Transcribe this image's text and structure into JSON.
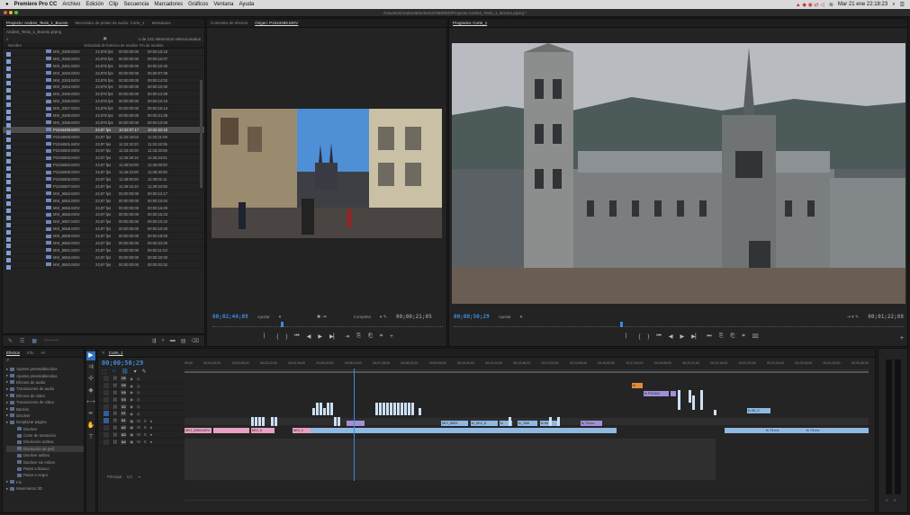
{
  "menubar": {
    "app": "Premiere Pro CC",
    "items": [
      "Archivo",
      "Edición",
      "Clip",
      "Secuencia",
      "Marcadores",
      "Gráficos",
      "Ventana",
      "Ayuda"
    ],
    "clock": "Mar 21 ene 22:18:23"
  },
  "window_title": "/Usuarios/Andres/Escritorio/ANDRES/Proyecto Andres_Tesis_1_Boceto.prproj *",
  "project": {
    "tabs": [
      "Proyecto: Andres_Tesis_1_Boceto",
      "Mezclador de pistas de audio: Corte_1",
      "Metadatos"
    ],
    "file": "Andres_Tesis_1_Boceto.prproj",
    "count": "1 de 131 elementos seleccionados",
    "columns": [
      "Nombre",
      "Velocidad de fotograma",
      "Inicio de medios",
      "Fin de medios"
    ],
    "rows": [
      {
        "name": "MVI_0259.MOV",
        "fps": "23,976 fps",
        "start": "00:00:00:00",
        "end": "00:00:15:16"
      },
      {
        "name": "MVI_0260.MOV",
        "fps": "23,976 fps",
        "start": "00:00:00:00",
        "end": "00:00:15:07"
      },
      {
        "name": "MVI_0261.MOV",
        "fps": "23,976 fps",
        "start": "00:00:00:00",
        "end": "00:00:10:20"
      },
      {
        "name": "MVI_0262.MOV",
        "fps": "23,976 fps",
        "start": "00:00:00:00",
        "end": "00:00:07:09"
      },
      {
        "name": "MVI_0263.MOV",
        "fps": "23,976 fps",
        "start": "00:00:00:00",
        "end": "00:00:14:02"
      },
      {
        "name": "MVI_0264.MOV",
        "fps": "23,976 fps",
        "start": "00:00:00:00",
        "end": "00:00:10:00"
      },
      {
        "name": "MVI_0265.MOV",
        "fps": "23,976 fps",
        "start": "00:00:00:00",
        "end": "00:00:12:09"
      },
      {
        "name": "MVI_0266.MOV",
        "fps": "23,976 fps",
        "start": "00:00:00:00",
        "end": "00:00:10:16"
      },
      {
        "name": "MVI_0267.MOV",
        "fps": "23,976 fps",
        "start": "00:00:00:00",
        "end": "00:00:15:14"
      },
      {
        "name": "MVI_0268.MOV",
        "fps": "23,976 fps",
        "start": "00:00:00:00",
        "end": "00:00:21:06"
      },
      {
        "name": "MVI_0269.MOV",
        "fps": "23,976 fps",
        "start": "00:00:00:00",
        "end": "00:00:10:09"
      },
      {
        "name": "P1044499.MOV",
        "fps": "23,97 fps",
        "start": "10:22:07:17",
        "end": "10:22:22:10",
        "selected": true
      },
      {
        "name": "P1044500.MOV",
        "fps": "23,97 fps",
        "start": "11:32:18:03",
        "end": "11:32:21:09"
      },
      {
        "name": "P1044501.MOV",
        "fps": "23,97 fps",
        "start": "11:32:32:20",
        "end": "11:32:42:05"
      },
      {
        "name": "P1044502.MOV",
        "fps": "23,97 fps",
        "start": "11:33:25:00",
        "end": "11:33:33:08"
      },
      {
        "name": "P1044503.MOV",
        "fps": "23,97 fps",
        "start": "11:35:39:16",
        "end": "11:35:44:01"
      },
      {
        "name": "P1044504.MOV",
        "fps": "23,97 fps",
        "start": "11:35:54:00",
        "end": "11:36:00:00"
      },
      {
        "name": "P1044505.MOV",
        "fps": "23,97 fps",
        "start": "11:36:23:00",
        "end": "11:36:30:05"
      },
      {
        "name": "P1044506.MOV",
        "fps": "23,97 fps",
        "start": "11:38:50:00",
        "end": "11:39:01:11"
      },
      {
        "name": "P1044507.MOV",
        "fps": "23,97 fps",
        "start": "11:39:16:10",
        "end": "11:39:23:08"
      },
      {
        "name": "MVI_6553.MOV",
        "fps": "23,97 fps",
        "start": "00:00:00:00",
        "end": "00:00:12:17"
      },
      {
        "name": "MVI_6554.MOV",
        "fps": "23,97 fps",
        "start": "00:00:00:00",
        "end": "00:00:10:04"
      },
      {
        "name": "MVI_6555.MOV",
        "fps": "23,97 fps",
        "start": "00:00:00:00",
        "end": "00:00:16:00"
      },
      {
        "name": "MVI_6556.MOV",
        "fps": "23,97 fps",
        "start": "00:00:00:00",
        "end": "00:00:15:23"
      },
      {
        "name": "MVI_6557.MOV",
        "fps": "23,97 fps",
        "start": "00:00:00:00",
        "end": "00:00:10:22"
      },
      {
        "name": "MVI_6558.MOV",
        "fps": "23,97 fps",
        "start": "00:00:00:00",
        "end": "00:00:19:00"
      },
      {
        "name": "MVI_6559.MOV",
        "fps": "23,97 fps",
        "start": "00:00:00:00",
        "end": "00:00:18:00"
      },
      {
        "name": "MVI_6560.MOV",
        "fps": "23,97 fps",
        "start": "00:00:00:00",
        "end": "00:00:22:00"
      },
      {
        "name": "MVI_6561.MOV",
        "fps": "23,97 fps",
        "start": "00:00:00:00",
        "end": "00:00:11:03"
      },
      {
        "name": "MVI_6562.MOV",
        "fps": "23,97 fps",
        "start": "00:00:00:00",
        "end": "00:00:20:00"
      },
      {
        "name": "MVI_6563.MOV",
        "fps": "23,97 fps",
        "start": "00:00:00:00",
        "end": "00:00:22:02"
      }
    ]
  },
  "source": {
    "tabs": [
      "Controles de efectos",
      "Origen: P1044499.MOV"
    ],
    "timecode": "00;02;44;09",
    "fit": "Ajustar",
    "quality": "Completa",
    "duration": "00;00;21;05",
    "controls": [
      "⎸",
      "{",
      "}",
      "⏮",
      "◀",
      "▶",
      "▶▏",
      "⇥",
      "⎘",
      "⎗",
      "⌗",
      "+"
    ]
  },
  "program": {
    "tab": "Programa: Corte_1",
    "timecode": "00;00;50;29",
    "fit": "Ajustar",
    "duration": "00;01;22;08",
    "controls": [
      "⎸",
      "{",
      "}",
      "⏮",
      "◀",
      "▶",
      "▶▏",
      "⏭",
      "⎘",
      "⎗",
      "⌗",
      "⌧"
    ]
  },
  "effects": {
    "tabs": [
      "Efectos",
      "Info",
      "Hi"
    ],
    "items": [
      "Ajustes preestablecidos",
      "Ajustes preestablecidos",
      "Efectos de audio",
      "Transiciones de audio",
      "Efectos de vídeo",
      "Transiciones de vídeo",
      "Barrido",
      "Disolver",
      "Desplazar página",
      "Disolver",
      "Corte de transición",
      "Disolución aditiva",
      "Disolución de pelí",
      "Disolver aditivo",
      "Disolver sin esfum",
      "Pasar a blanco",
      "Pasar a negro",
      "Iris",
      "Movimiento 3D"
    ]
  },
  "timeline": {
    "tab": "Corte_1",
    "timecode": "00;00;50;29",
    "ruler": [
      "00;00",
      "00;01;04;00",
      "00;02;08;00",
      "00;03;12;00",
      "00;04;16;00",
      "00;05;20;00",
      "00;06;24;00",
      "00;07;28;00",
      "00;08;32;00",
      "00;09;36;00",
      "00;10;40;00",
      "00;11;44;00",
      "00;12;48;00",
      "00;13;52;00",
      "00;14;56;00",
      "00;16;00;00",
      "00;17;04;00",
      "00;18;08;00",
      "00;19;12;00",
      "00;20;16;00",
      "00;21;20;00",
      "00;22;24;00",
      "00;23;28;00",
      "00;24;32;00",
      "00;25;36;00"
    ],
    "tracks": [
      "V6",
      "V5",
      "V4",
      "V3",
      "V2",
      "V1",
      "A1",
      "A2",
      "A3",
      "A4"
    ],
    "master": "Principal",
    "master_value": "0,0",
    "clips": {
      "v5a": "fx",
      "v5b": "fx  P10441",
      "v1a": "MVI_0259.MOV",
      "v1b": "MVI_0",
      "v2a": "MVI_1",
      "v2b": "MVI_6553",
      "v2c": "fx_MVI_6",
      "v2d": "fx",
      "v2e": "fx_S66",
      "v2f": "fx 60",
      "v2g": "fx 73.mv",
      "v2h": "fx 73.mv",
      "v2i": "fx 73.mv",
      "v3a": "fx  IM_0"
    }
  },
  "meter": {
    "labels": [
      "S",
      "S"
    ]
  },
  "colors": {
    "accent": "#3c8be0",
    "clip_purple": "#a190d6",
    "clip_blue": "#8fb8e3",
    "clip_pink": "#e8a0c4",
    "selected": "#4d4d4d"
  }
}
